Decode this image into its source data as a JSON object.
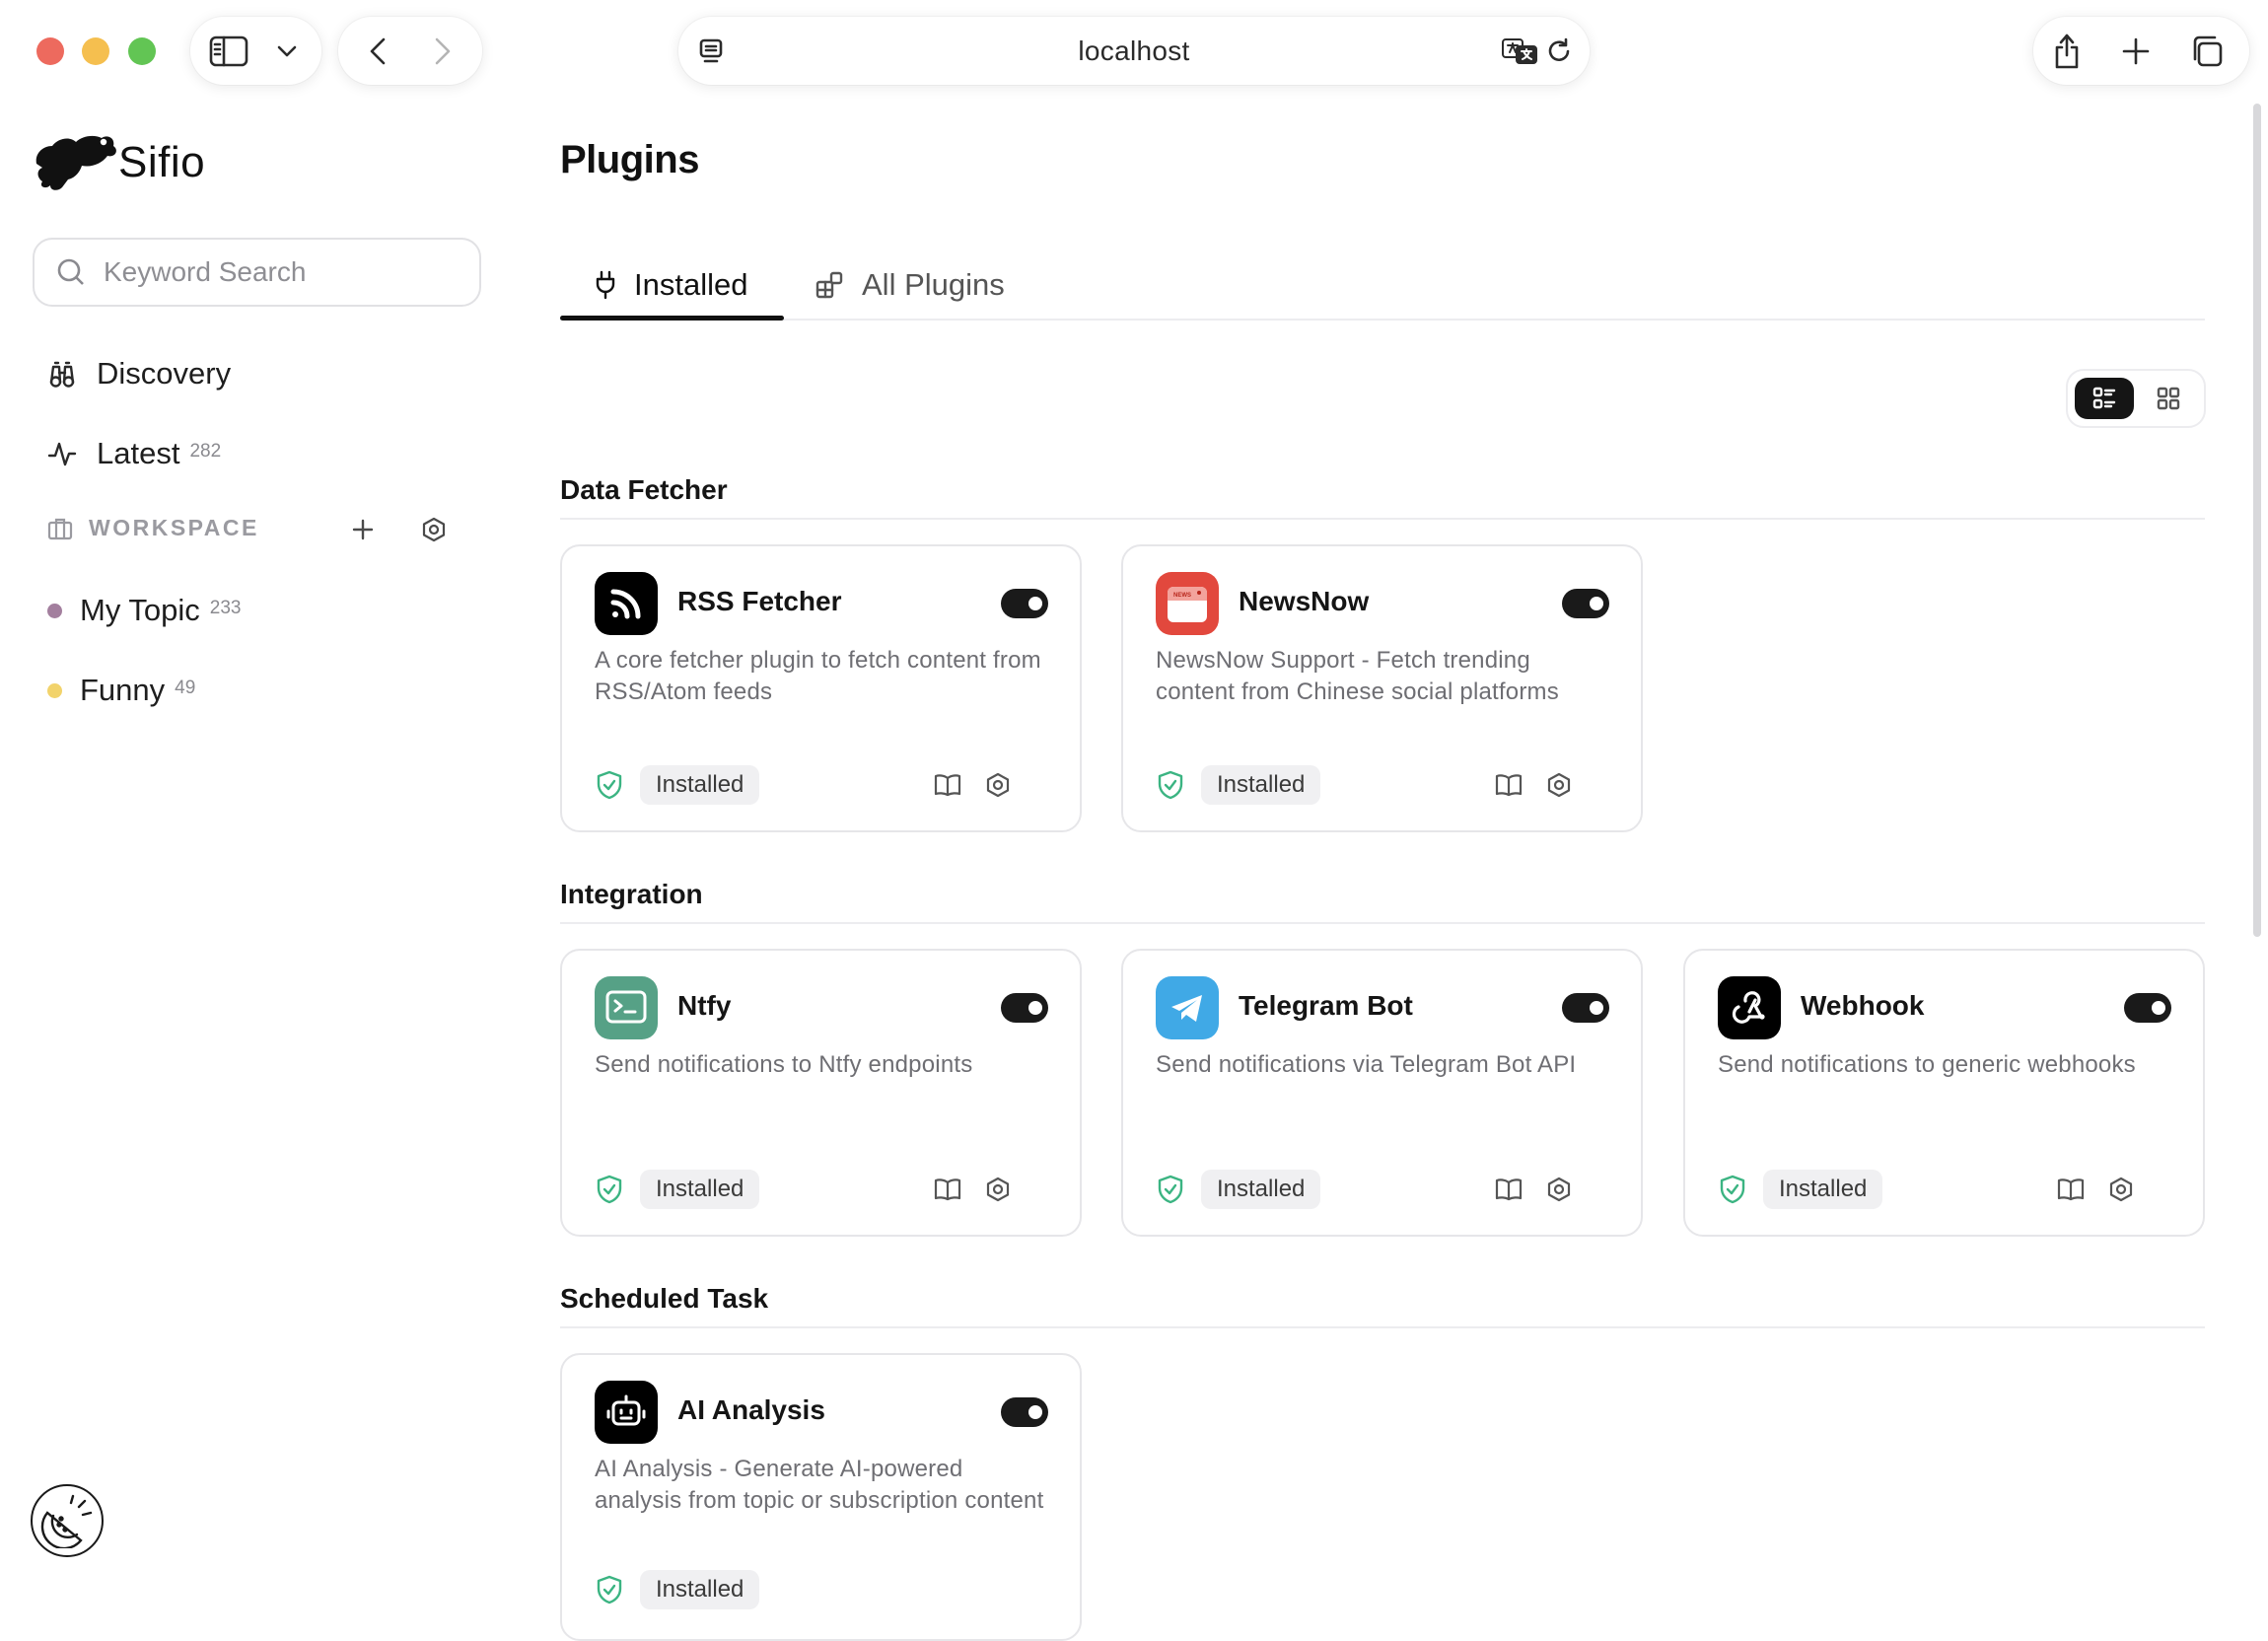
{
  "browser": {
    "url": "localhost",
    "colors": {
      "close": "#ed6a5e",
      "minimize": "#f5bf4f",
      "maximize": "#62c554"
    }
  },
  "app": {
    "name": "Sifio"
  },
  "search": {
    "placeholder": "Keyword Search",
    "value": ""
  },
  "nav": {
    "discovery": {
      "label": "Discovery",
      "icon": "binoculars-icon"
    },
    "latest": {
      "label": "Latest",
      "count": "282",
      "icon": "activity-icon"
    }
  },
  "workspace": {
    "label": "WORKSPACE",
    "topics": [
      {
        "label": "My Topic",
        "count": "233",
        "color": "#a37f9e"
      },
      {
        "label": "Funny",
        "count": "49",
        "color": "#f2d36b"
      }
    ]
  },
  "page": {
    "title": "Plugins"
  },
  "tabs": [
    {
      "label": "Installed",
      "active": true,
      "icon": "plug-icon"
    },
    {
      "label": "All Plugins",
      "active": false,
      "icon": "puzzle-icon"
    }
  ],
  "view": {
    "active": "list"
  },
  "sections": [
    {
      "title": "Data Fetcher",
      "plugins": [
        {
          "name": "RSS Fetcher",
          "description": "A core fetcher plugin to fetch content from RSS/Atom feeds",
          "status": "Installed",
          "enabled": true,
          "logo": "rss-icon",
          "logo_color": "#000000"
        },
        {
          "name": "NewsNow",
          "description": "NewsNow Support - Fetch trending content from Chinese social platforms",
          "status": "Installed",
          "enabled": true,
          "logo": "newsnow-icon",
          "logo_color": "#e2483d"
        }
      ]
    },
    {
      "title": "Integration",
      "plugins": [
        {
          "name": "Ntfy",
          "description": "Send notifications to Ntfy endpoints",
          "status": "Installed",
          "enabled": true,
          "logo": "terminal-icon",
          "logo_color": "#56a186"
        },
        {
          "name": "Telegram Bot",
          "description": "Send notifications via Telegram Bot API",
          "status": "Installed",
          "enabled": true,
          "logo": "telegram-icon",
          "logo_color": "#40a9e6"
        },
        {
          "name": "Webhook",
          "description": "Send notifications to generic webhooks",
          "status": "Installed",
          "enabled": true,
          "logo": "webhook-icon",
          "logo_color": "#000000"
        }
      ]
    },
    {
      "title": "Scheduled Task",
      "plugins": [
        {
          "name": "AI Analysis",
          "description": "AI Analysis - Generate AI-powered analysis from topic or subscription content",
          "status": "Installed",
          "enabled": true,
          "logo": "robot-icon",
          "logo_color": "#000000"
        }
      ]
    }
  ]
}
